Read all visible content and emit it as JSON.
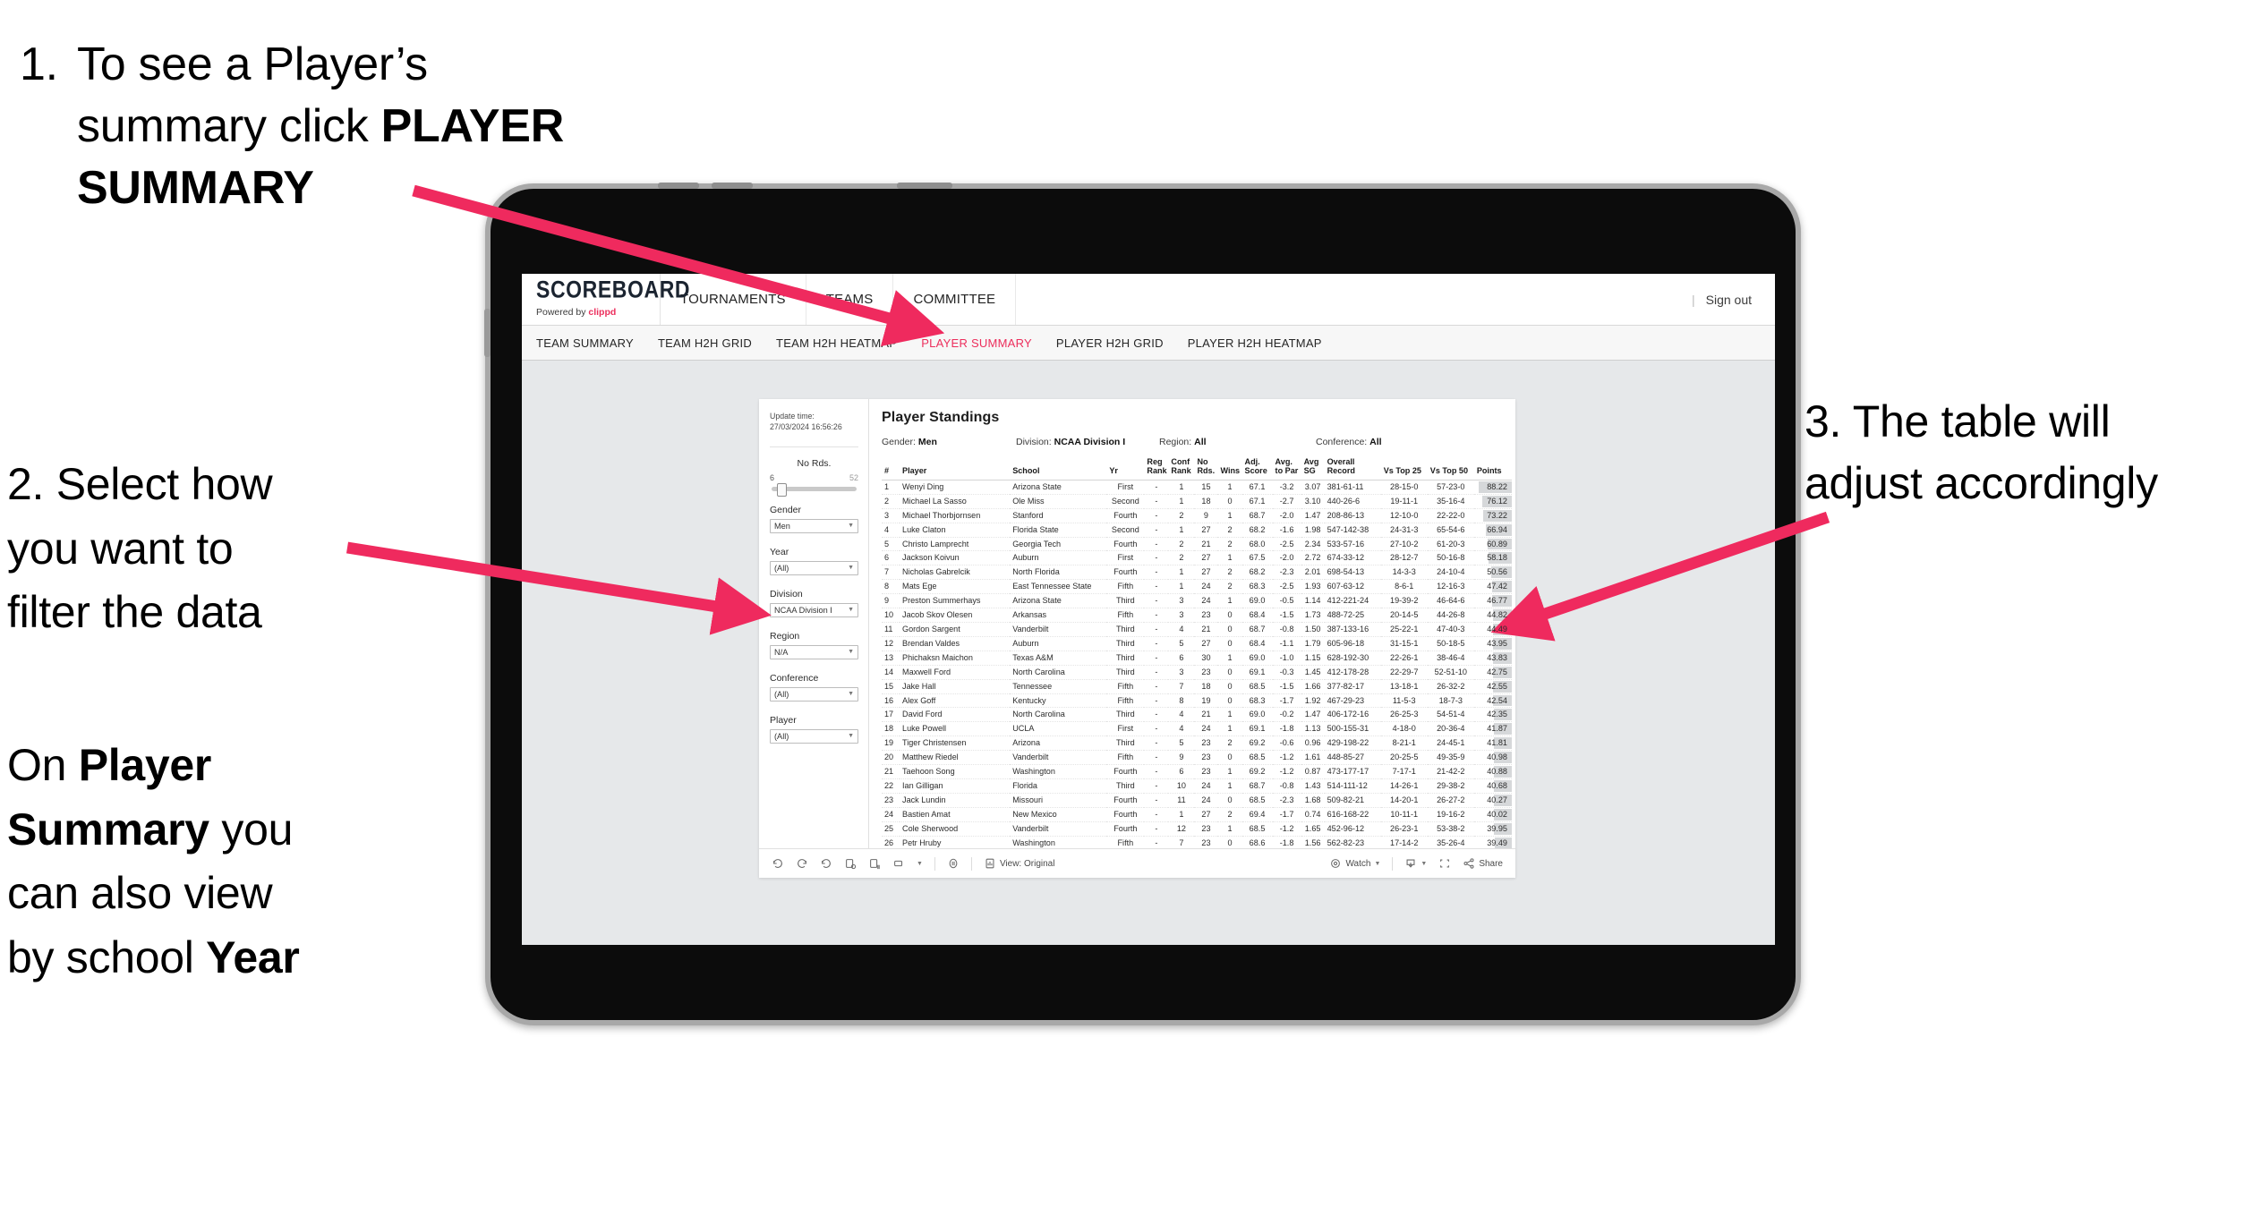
{
  "annotations": {
    "step1": {
      "number": "1.",
      "text_before": "To see a Player’s summary click ",
      "line1": "To see a Player’s",
      "line2_pre": "summary click ",
      "line2_bold": "PLAYER",
      "line3_bold": "SUMMARY"
    },
    "step2": {
      "line1": "2. Select how",
      "line2": "you want to",
      "line3": "filter the data"
    },
    "step2b": {
      "pre1": "On ",
      "bold1": "Player",
      "bold2": "Summary",
      "mid": " you",
      "line3": "can also view",
      "line4_pre": "by school ",
      "line4_bold": "Year"
    },
    "step3": {
      "line1": "3. The table will",
      "line2": "adjust accordingly"
    }
  },
  "app": {
    "brand": {
      "title": "SCOREBOARD",
      "powered_prefix": "Powered by ",
      "powered_name": "clippd"
    },
    "topnav": [
      "TOURNAMENTS",
      "TEAMS",
      "COMMITTEE"
    ],
    "account": {
      "divider": "|",
      "sign_out": "Sign out"
    },
    "tabs": [
      {
        "label": "TEAM SUMMARY",
        "active": false
      },
      {
        "label": "TEAM H2H GRID",
        "active": false
      },
      {
        "label": "TEAM H2H HEATMAP",
        "active": false
      },
      {
        "label": "PLAYER SUMMARY",
        "active": true
      },
      {
        "label": "PLAYER H2H GRID",
        "active": false
      },
      {
        "label": "PLAYER H2H HEATMAP",
        "active": false
      }
    ],
    "accent_color": "#ec2e5c"
  },
  "filters": {
    "update_label": "Update time:",
    "update_time": "27/03/2024 16:56:26",
    "slider": {
      "title": "No Rds.",
      "min": "6",
      "max": "52",
      "value_pct": 6
    },
    "controls": [
      {
        "label": "Gender",
        "value": "Men"
      },
      {
        "label": "Year",
        "value": "(All)"
      },
      {
        "label": "Division",
        "value": "NCAA Division I"
      },
      {
        "label": "Region",
        "value": "N/A"
      },
      {
        "label": "Conference",
        "value": "(All)"
      },
      {
        "label": "Player",
        "value": "(All)"
      }
    ]
  },
  "standings": {
    "title": "Player Standings",
    "meta": [
      {
        "label": "Gender: ",
        "value": "Men"
      },
      {
        "label": "Division: ",
        "value": "NCAA Division I"
      },
      {
        "label": "Region: ",
        "value": "All"
      },
      {
        "label": "Conference: ",
        "value": "All"
      }
    ],
    "columns": [
      {
        "key": "rank",
        "header": "#"
      },
      {
        "key": "player",
        "header": "Player"
      },
      {
        "key": "school",
        "header": "School"
      },
      {
        "key": "yr",
        "header": "Yr"
      },
      {
        "key": "reg_rank",
        "header": "Reg Rank"
      },
      {
        "key": "conf_rank",
        "header": "Conf Rank"
      },
      {
        "key": "no_rds",
        "header": "No Rds."
      },
      {
        "key": "wins",
        "header": "Wins"
      },
      {
        "key": "adj_score",
        "header": "Adj. Score"
      },
      {
        "key": "avg_to_par",
        "header": "Avg. to Par"
      },
      {
        "key": "avg_sg",
        "header": "Avg SG"
      },
      {
        "key": "overall_record",
        "header": "Overall Record"
      },
      {
        "key": "vs_top_25",
        "header": "Vs Top 25"
      },
      {
        "key": "vs_top_50",
        "header": "Vs Top 50"
      },
      {
        "key": "points",
        "header": "Points"
      }
    ],
    "rows": [
      [
        "1",
        "Wenyi Ding",
        "Arizona State",
        "First",
        "-",
        "1",
        "15",
        "1",
        "67.1",
        "-3.2",
        "3.07",
        "381-61-11",
        "28-15-0",
        "57-23-0",
        "88.22"
      ],
      [
        "2",
        "Michael La Sasso",
        "Ole Miss",
        "Second",
        "-",
        "1",
        "18",
        "0",
        "67.1",
        "-2.7",
        "3.10",
        "440-26-6",
        "19-11-1",
        "35-16-4",
        "76.12"
      ],
      [
        "3",
        "Michael Thorbjornsen",
        "Stanford",
        "Fourth",
        "-",
        "2",
        "9",
        "1",
        "68.7",
        "-2.0",
        "1.47",
        "208-86-13",
        "12-10-0",
        "22-22-0",
        "73.22"
      ],
      [
        "4",
        "Luke Claton",
        "Florida State",
        "Second",
        "-",
        "1",
        "27",
        "2",
        "68.2",
        "-1.6",
        "1.98",
        "547-142-38",
        "24-31-3",
        "65-54-6",
        "66.94"
      ],
      [
        "5",
        "Christo Lamprecht",
        "Georgia Tech",
        "Fourth",
        "-",
        "2",
        "21",
        "2",
        "68.0",
        "-2.5",
        "2.34",
        "533-57-16",
        "27-10-2",
        "61-20-3",
        "60.89"
      ],
      [
        "6",
        "Jackson Koivun",
        "Auburn",
        "First",
        "-",
        "2",
        "27",
        "1",
        "67.5",
        "-2.0",
        "2.72",
        "674-33-12",
        "28-12-7",
        "50-16-8",
        "58.18"
      ],
      [
        "7",
        "Nicholas Gabrelcik",
        "North Florida",
        "Fourth",
        "-",
        "1",
        "27",
        "2",
        "68.2",
        "-2.3",
        "2.01",
        "698-54-13",
        "14-3-3",
        "24-10-4",
        "50.56"
      ],
      [
        "8",
        "Mats Ege",
        "East Tennessee State",
        "Fifth",
        "-",
        "1",
        "24",
        "2",
        "68.3",
        "-2.5",
        "1.93",
        "607-63-12",
        "8-6-1",
        "12-16-3",
        "47.42"
      ],
      [
        "9",
        "Preston Summerhays",
        "Arizona State",
        "Third",
        "-",
        "3",
        "24",
        "1",
        "69.0",
        "-0.5",
        "1.14",
        "412-221-24",
        "19-39-2",
        "46-64-6",
        "46.77"
      ],
      [
        "10",
        "Jacob Skov Olesen",
        "Arkansas",
        "Fifth",
        "-",
        "3",
        "23",
        "0",
        "68.4",
        "-1.5",
        "1.73",
        "488-72-25",
        "20-14-5",
        "44-26-8",
        "44.82"
      ],
      [
        "11",
        "Gordon Sargent",
        "Vanderbilt",
        "Third",
        "-",
        "4",
        "21",
        "0",
        "68.7",
        "-0.8",
        "1.50",
        "387-133-16",
        "25-22-1",
        "47-40-3",
        "44.49"
      ],
      [
        "12",
        "Brendan Valdes",
        "Auburn",
        "Third",
        "-",
        "5",
        "27",
        "0",
        "68.4",
        "-1.1",
        "1.79",
        "605-96-18",
        "31-15-1",
        "50-18-5",
        "43.95"
      ],
      [
        "13",
        "Phichaksn Maichon",
        "Texas A&M",
        "Third",
        "-",
        "6",
        "30",
        "1",
        "69.0",
        "-1.0",
        "1.15",
        "628-192-30",
        "22-26-1",
        "38-46-4",
        "43.83"
      ],
      [
        "14",
        "Maxwell Ford",
        "North Carolina",
        "Third",
        "-",
        "3",
        "23",
        "0",
        "69.1",
        "-0.3",
        "1.45",
        "412-178-28",
        "22-29-7",
        "52-51-10",
        "42.75"
      ],
      [
        "15",
        "Jake Hall",
        "Tennessee",
        "Fifth",
        "-",
        "7",
        "18",
        "0",
        "68.5",
        "-1.5",
        "1.66",
        "377-82-17",
        "13-18-1",
        "26-32-2",
        "42.55"
      ],
      [
        "16",
        "Alex Goff",
        "Kentucky",
        "Fifth",
        "-",
        "8",
        "19",
        "0",
        "68.3",
        "-1.7",
        "1.92",
        "467-29-23",
        "11-5-3",
        "18-7-3",
        "42.54"
      ],
      [
        "17",
        "David Ford",
        "North Carolina",
        "Third",
        "-",
        "4",
        "21",
        "1",
        "69.0",
        "-0.2",
        "1.47",
        "406-172-16",
        "26-25-3",
        "54-51-4",
        "42.35"
      ],
      [
        "18",
        "Luke Powell",
        "UCLA",
        "First",
        "-",
        "4",
        "24",
        "1",
        "69.1",
        "-1.8",
        "1.13",
        "500-155-31",
        "4-18-0",
        "20-36-4",
        "41.87"
      ],
      [
        "19",
        "Tiger Christensen",
        "Arizona",
        "Third",
        "-",
        "5",
        "23",
        "2",
        "69.2",
        "-0.6",
        "0.96",
        "429-198-22",
        "8-21-1",
        "24-45-1",
        "41.81"
      ],
      [
        "20",
        "Matthew Riedel",
        "Vanderbilt",
        "Fifth",
        "-",
        "9",
        "23",
        "0",
        "68.5",
        "-1.2",
        "1.61",
        "448-85-27",
        "20-25-5",
        "49-35-9",
        "40.98"
      ],
      [
        "21",
        "Taehoon Song",
        "Washington",
        "Fourth",
        "-",
        "6",
        "23",
        "1",
        "69.2",
        "-1.2",
        "0.87",
        "473-177-17",
        "7-17-1",
        "21-42-2",
        "40.88"
      ],
      [
        "22",
        "Ian Gilligan",
        "Florida",
        "Third",
        "-",
        "10",
        "24",
        "1",
        "68.7",
        "-0.8",
        "1.43",
        "514-111-12",
        "14-26-1",
        "29-38-2",
        "40.68"
      ],
      [
        "23",
        "Jack Lundin",
        "Missouri",
        "Fourth",
        "-",
        "11",
        "24",
        "0",
        "68.5",
        "-2.3",
        "1.68",
        "509-82-21",
        "14-20-1",
        "26-27-2",
        "40.27"
      ],
      [
        "24",
        "Bastien Amat",
        "New Mexico",
        "Fourth",
        "-",
        "1",
        "27",
        "2",
        "69.4",
        "-1.7",
        "0.74",
        "616-168-22",
        "10-11-1",
        "19-16-2",
        "40.02"
      ],
      [
        "25",
        "Cole Sherwood",
        "Vanderbilt",
        "Fourth",
        "-",
        "12",
        "23",
        "1",
        "68.5",
        "-1.2",
        "1.65",
        "452-96-12",
        "26-23-1",
        "53-38-2",
        "39.95"
      ],
      [
        "26",
        "Petr Hruby",
        "Washington",
        "Fifth",
        "-",
        "7",
        "23",
        "0",
        "68.6",
        "-1.8",
        "1.56",
        "562-82-23",
        "17-14-2",
        "35-26-4",
        "39.49"
      ]
    ]
  },
  "toolbar": {
    "view_label": "View: Original",
    "watch_label": "Watch",
    "share_label": "Share"
  }
}
